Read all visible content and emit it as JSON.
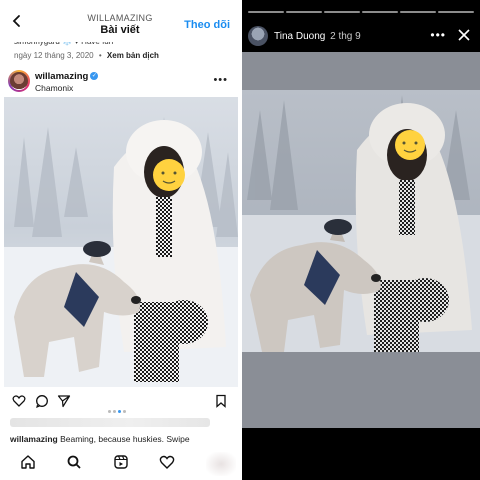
{
  "left_panel": {
    "header": {
      "username": "WILLAMAZING",
      "title": "Bài viết",
      "follow_label": "Theo dõi"
    },
    "previous_post_line": "simonnygard ❄️ ♥ Have fun",
    "date_row": {
      "date": "ngày 12 tháng 3, 2020",
      "separator": "•",
      "translate_label": "Xem bản dịch"
    },
    "post": {
      "username": "willamazing",
      "verified_mark": "✓",
      "location": "Chamonix",
      "more_label": "•••",
      "caption_user": "willamazing",
      "caption_text": " Beaming, because huskies. Swipe"
    },
    "icons": {
      "back": "back-chevron-icon",
      "like": "heart-icon",
      "comment": "comment-icon",
      "share": "send-icon",
      "save": "bookmark-icon",
      "nav": [
        "home-icon",
        "search-icon",
        "reels-icon",
        "heart-icon"
      ]
    },
    "carousel": {
      "count": 4,
      "active": 3
    },
    "colors": {
      "accent": "#1a8cf0",
      "verified": "#3897f0"
    }
  },
  "right_panel": {
    "story": {
      "username": "Tina Duong",
      "time": "2 thg 9",
      "more_label": "•••"
    },
    "icons": {
      "close": "close-icon",
      "avatar": "avatar"
    },
    "progress_segments": 6,
    "colors": {
      "background": "#000000",
      "story_backdrop": "#8a8e96"
    }
  }
}
